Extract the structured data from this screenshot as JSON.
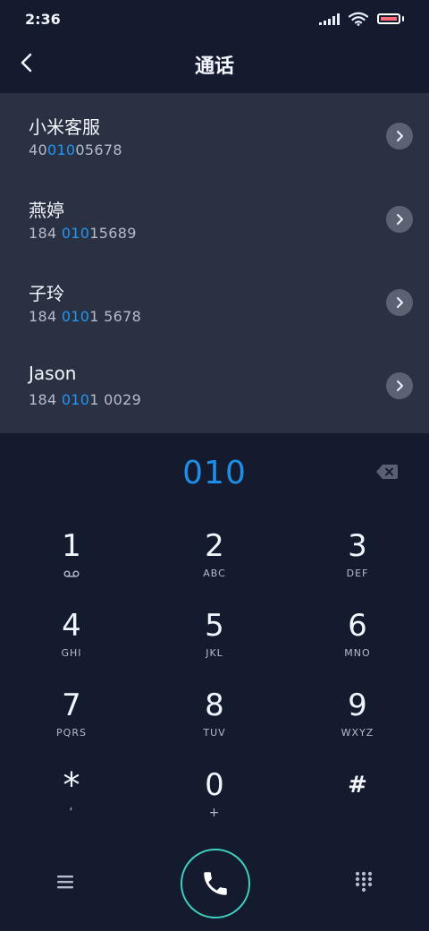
{
  "status_bar": {
    "time": "2:36",
    "icons": [
      "signal-icon",
      "wifi-icon",
      "battery-icon"
    ]
  },
  "header": {
    "title": "通话",
    "back_icon": "back-arrow-icon"
  },
  "contacts": [
    {
      "name": "小米客服",
      "number_pre": "40",
      "number_match": "010",
      "number_post": "05678"
    },
    {
      "name": "燕婷",
      "number_pre": "184 ",
      "number_match": "010",
      "number_post": "15689"
    },
    {
      "name": "子玲",
      "number_pre": "184 ",
      "number_match": "010",
      "number_post": "1 5678"
    },
    {
      "name": "Jason",
      "number_pre": "184 ",
      "number_match": "010",
      "number_post": "1 0029"
    }
  ],
  "dialer": {
    "digits": "010",
    "keys": [
      {
        "num": "1",
        "sub": ""
      },
      {
        "num": "2",
        "sub": "ABC"
      },
      {
        "num": "3",
        "sub": "DEF"
      },
      {
        "num": "4",
        "sub": "GHI"
      },
      {
        "num": "5",
        "sub": "JKL"
      },
      {
        "num": "6",
        "sub": "MNO"
      },
      {
        "num": "7",
        "sub": "PQRS"
      },
      {
        "num": "8",
        "sub": "TUV"
      },
      {
        "num": "9",
        "sub": "WXYZ"
      },
      {
        "num": "*",
        "sub": ","
      },
      {
        "num": "0",
        "sub": "+"
      },
      {
        "num": "#",
        "sub": ""
      }
    ]
  },
  "bottom_bar": {
    "icons": [
      "menu-icon",
      "phone-icon",
      "dialpad-icon"
    ]
  },
  "colors": {
    "background": "#151b2e",
    "list_background": "#2a3142",
    "accent_blue": "#2196f3",
    "call_ring": "#3fd1c1"
  }
}
